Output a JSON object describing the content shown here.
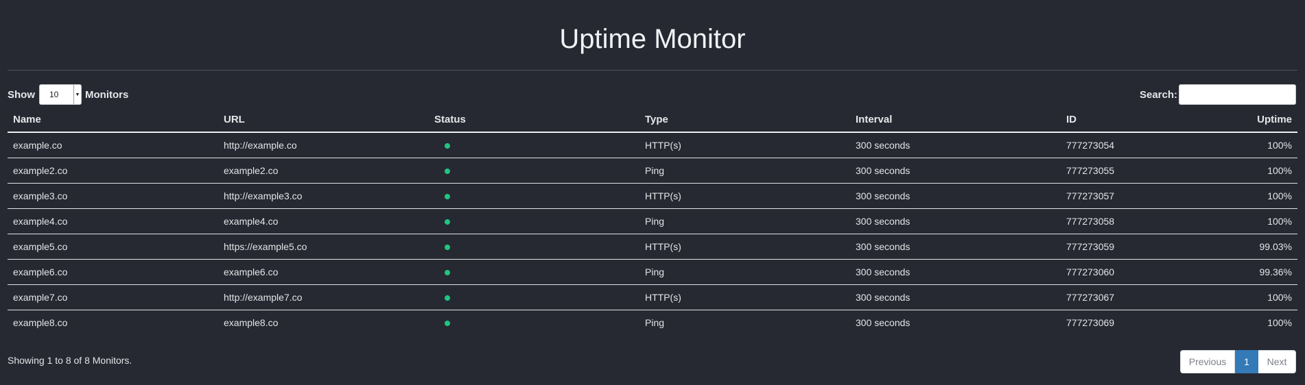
{
  "page": {
    "title": "Uptime Monitor"
  },
  "controls": {
    "show_label": "Show",
    "page_length": "10",
    "monitors_label": "Monitors",
    "search_label": "Search:",
    "search_value": ""
  },
  "table": {
    "headers": [
      "Name",
      "URL",
      "Status",
      "Type",
      "Interval",
      "ID",
      "Uptime"
    ],
    "status_color": "#21c47f",
    "rows": [
      {
        "name": "example.co",
        "url": "http://example.co",
        "status": "up",
        "type": "HTTP(s)",
        "interval": "300 seconds",
        "id": "777273054",
        "uptime": "100%"
      },
      {
        "name": "example2.co",
        "url": "example2.co",
        "status": "up",
        "type": "Ping",
        "interval": "300 seconds",
        "id": "777273055",
        "uptime": "100%"
      },
      {
        "name": "example3.co",
        "url": "http://example3.co",
        "status": "up",
        "type": "HTTP(s)",
        "interval": "300 seconds",
        "id": "777273057",
        "uptime": "100%"
      },
      {
        "name": "example4.co",
        "url": "example4.co",
        "status": "up",
        "type": "Ping",
        "interval": "300 seconds",
        "id": "777273058",
        "uptime": "100%"
      },
      {
        "name": "example5.co",
        "url": "https://example5.co",
        "status": "up",
        "type": "HTTP(s)",
        "interval": "300 seconds",
        "id": "777273059",
        "uptime": "99.03%"
      },
      {
        "name": "example6.co",
        "url": "example6.co",
        "status": "up",
        "type": "Ping",
        "interval": "300 seconds",
        "id": "777273060",
        "uptime": "99.36%"
      },
      {
        "name": "example7.co",
        "url": "http://example7.co",
        "status": "up",
        "type": "HTTP(s)",
        "interval": "300 seconds",
        "id": "777273067",
        "uptime": "100%"
      },
      {
        "name": "example8.co",
        "url": "example8.co",
        "status": "up",
        "type": "Ping",
        "interval": "300 seconds",
        "id": "777273069",
        "uptime": "100%"
      }
    ]
  },
  "footer": {
    "info": "Showing 1 to 8 of 8 Monitors.",
    "previous_label": "Previous",
    "current_page": "1",
    "next_label": "Next"
  }
}
